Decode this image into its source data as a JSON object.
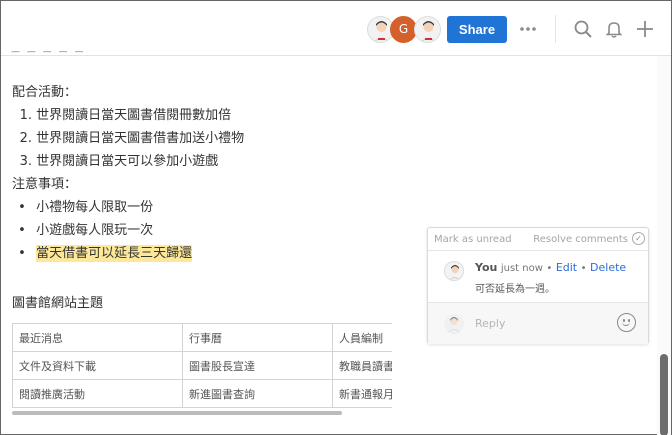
{
  "toolbar": {
    "share_label": "Share",
    "avatar_g_letter": "G",
    "link_stub": "— — — — —",
    "icons": [
      "more-icon",
      "search-icon",
      "bell-icon",
      "plus-icon"
    ]
  },
  "document": {
    "activities_heading": "配合活動：",
    "activities": [
      {
        "num": "1.",
        "text": "世界閱讀日當天圖書借閱冊數加倍"
      },
      {
        "num": "2.",
        "text": "世界閱讀日當天圖書借書加送小禮物"
      },
      {
        "num": "3.",
        "text": "世界閱讀日當天可以參加小遊戲"
      }
    ],
    "notes_heading": "注意事項：",
    "notes": [
      {
        "bullet": "•",
        "text": "小禮物每人限取一份"
      },
      {
        "bullet": "•",
        "text": "小遊戲每人限玩一次"
      },
      {
        "bullet": "•",
        "text": "當天借書可以延長三天歸還"
      }
    ],
    "site_heading": "圖書館網站主題"
  },
  "table": {
    "rows": [
      [
        "最近消息",
        "行事曆",
        "人員編制"
      ],
      [
        "文件及資料下載",
        "圖書股長宣達",
        "教職員讀書"
      ],
      [
        "閱讀推廣活動",
        "新進圖書查詢",
        "新書通報月"
      ]
    ]
  },
  "comment": {
    "mark_unread": "Mark as unread",
    "resolve": "Resolve comments",
    "author": "You",
    "time": "just now",
    "sep": "•",
    "edit": "Edit",
    "delete": "Delete",
    "text": "可否延長為一週。",
    "reply_placeholder": "Reply"
  },
  "colors": {
    "accent": "#1f74d6",
    "highlight": "#fde89a",
    "avatar_g": "#d4602b"
  }
}
